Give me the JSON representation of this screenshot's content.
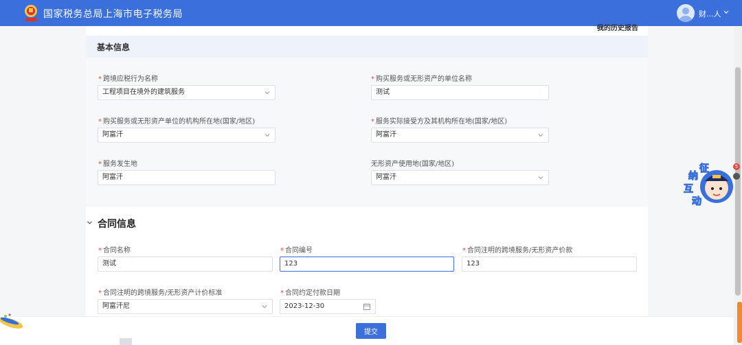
{
  "header": {
    "brand_title": "国家税务总局上海市电子税务局",
    "user_name": "财...人",
    "icons": [
      "tax-emblem-icon",
      "user-avatar-icon",
      "chevron-down-icon"
    ]
  },
  "top_link": "我的历史报告",
  "basic_info": {
    "title": "基本信息",
    "fields": {
      "cross_border_taxable": {
        "label": "跨境应税行为名称",
        "value": "工程项目在境外的建筑服务",
        "required": true
      },
      "purchaser_name": {
        "label": "购买服务或无形资产的单位名称",
        "value": "测试",
        "required": true
      },
      "purchaser_location": {
        "label": "购买服务或无形资产单位的机构所在地(国家/地区)",
        "value": "阿富汗",
        "required": true
      },
      "receiver_location": {
        "label": "服务实际接受方及其机构所在地(国家/地区)",
        "value": "阿富汗",
        "required": true
      },
      "service_place": {
        "label": "服务发生地",
        "value": "阿富汗",
        "required": true
      },
      "intangible_place": {
        "label": "无形资产使用地(国家/地区)",
        "value": "阿富汗",
        "required": false
      }
    }
  },
  "contract_info": {
    "title": "合同信息",
    "fields": {
      "contract_name": {
        "label": "合同名称",
        "value": "测试",
        "required": true
      },
      "contract_no": {
        "label": "合同编号",
        "value": "123",
        "required": true
      },
      "contract_price": {
        "label": "合同注明的跨境服务/无形资产价款",
        "value": "123",
        "required": true
      },
      "pricing_standard": {
        "label": "合同注明的跨境服务/无形资产计价标准",
        "value": "阿富汗尼",
        "required": true
      },
      "payment_date": {
        "label": "合同约定付款日期",
        "value": "2023-12-30",
        "required": true
      }
    }
  },
  "footer": {
    "submit_label": "提交"
  },
  "assistant": {
    "chars": [
      "征",
      "纳",
      "互",
      "动"
    ],
    "badge_count": "5"
  },
  "colors": {
    "primary": "#3a6fdc",
    "required": "#e5483f",
    "accent_orange": "#f08a24"
  }
}
